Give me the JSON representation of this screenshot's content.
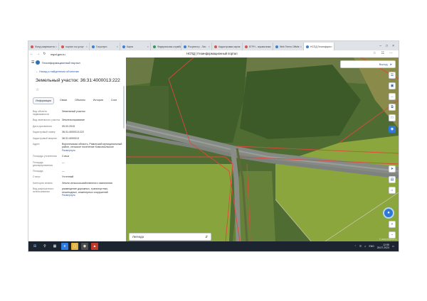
{
  "browser": {
    "tabs": [
      {
        "label": "Фонд капремонта",
        "color": "#d9534f"
      },
      {
        "label": "портал гос.услуг",
        "color": "#d9534f"
      },
      {
        "label": "Госуслуги",
        "color": "#3b7fd4"
      },
      {
        "label": "Карта",
        "color": "#3b7fd4"
      },
      {
        "label": "Федеральная служба",
        "color": "#2e9b55"
      },
      {
        "label": "Росреестр - Лич",
        "color": "#3b7fd4"
      },
      {
        "label": "Кадастровая карта",
        "color": "#d9534f"
      },
      {
        "label": "ЕГРН - справочная",
        "color": "#d9534f"
      },
      {
        "label": "Web Terms Offsite",
        "color": "#3b7fd4"
      },
      {
        "label": "НСПД Геоинформ",
        "color": "#3b7fd4",
        "active": true
      }
    ],
    "url": "nspd.gov.ru",
    "page_title": "НСПД | Геоинформационный портал"
  },
  "panel": {
    "brand": "Геоинформационный портал",
    "back_link": "Назад к найденным объектам",
    "object_title": "Земельный участок: 36:31:4000013:222",
    "tabs": [
      {
        "label": "Информация",
        "active": true
      },
      {
        "label": "Связи"
      },
      {
        "label": "Объекты"
      },
      {
        "label": "История"
      },
      {
        "label": "Сосе"
      }
    ],
    "properties": [
      {
        "label": "Вид объекта недвижимости",
        "value": "Земельный участок"
      },
      {
        "label": "Вид земельного участка",
        "value": "Землепользование"
      },
      {
        "label": "Дата присвоения",
        "value": "05.03.2015"
      },
      {
        "label": "Кадастровый номер",
        "value": "36:31:4000013:222"
      },
      {
        "label": "Кадастровый квартал",
        "value": "36:31:4000013"
      },
      {
        "label": "Адрес",
        "value": "Воронежская область, Рамонский муниципальный район, сельское поселение Комсомольское",
        "more": "Развернуть"
      },
      {
        "label": "Площадь уточненная",
        "value": "3 кв.м"
      },
      {
        "label": "Площадь декларированная",
        "value": "—"
      },
      {
        "label": "Площадь",
        "value": "—"
      },
      {
        "label": "Статус",
        "value": "Учтенный"
      },
      {
        "label": "Категория земель",
        "value": "Земли сельскохозяйственного назначения"
      },
      {
        "label": "Вид разрешенного использования",
        "value": "размещение дорожных, транспортных, пешеходных, инженерных сооружений",
        "more": "Развернуть"
      }
    ]
  },
  "map": {
    "exit_label": "Выход",
    "legend_label": "Легенда",
    "attribution": "© 2023 Росреестр",
    "tools": [
      "layers-icon",
      "print-icon",
      "ruler-icon",
      "share-icon",
      "car-icon",
      "info-icon"
    ]
  },
  "taskbar": {
    "time": "12:55",
    "date": "28.07.2023",
    "lang": "ENG"
  }
}
